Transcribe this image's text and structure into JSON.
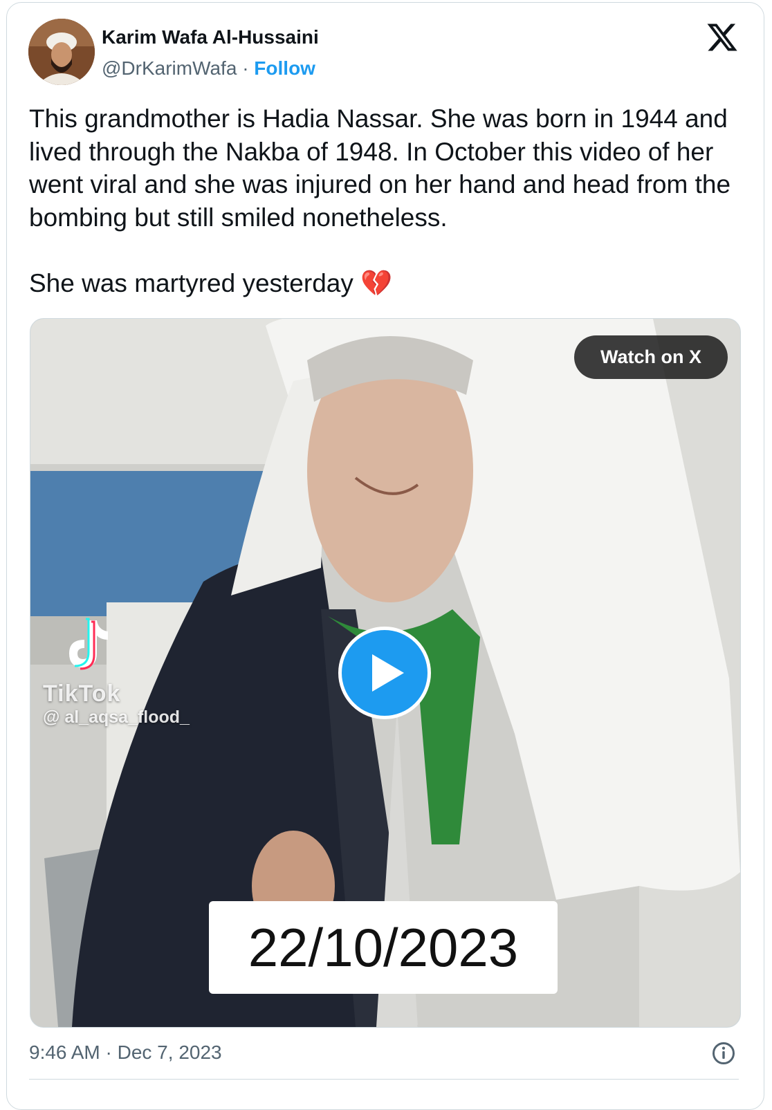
{
  "author": {
    "name": "Karim Wafa Al-Hussaini",
    "handle": "@DrKarimWafa",
    "separator": "·",
    "follow_label": "Follow"
  },
  "tweet": {
    "paragraph1": "This grandmother is Hadia Nassar. She was born in 1944 and lived through the Nakba of 1948.  In October this video of her went viral and she was injured on her hand and head from the bombing but still smiled nonetheless.",
    "paragraph2": "She was martyred yesterday",
    "emoji": "💔",
    "timestamp": "9:46 AM · Dec 7, 2023"
  },
  "media": {
    "watch_label": "Watch on X",
    "watermark_brand": "TikTok",
    "watermark_user": "@ al_aqsa_flood_",
    "overlay_date": "22/10/2023",
    "play_icon": "play-icon"
  },
  "icons": {
    "logo": "x-logo-icon",
    "info": "info-icon"
  },
  "colors": {
    "accent": "#1d9bf0",
    "text": "#0f1419",
    "muted": "#536471",
    "border": "#cfd9de"
  }
}
